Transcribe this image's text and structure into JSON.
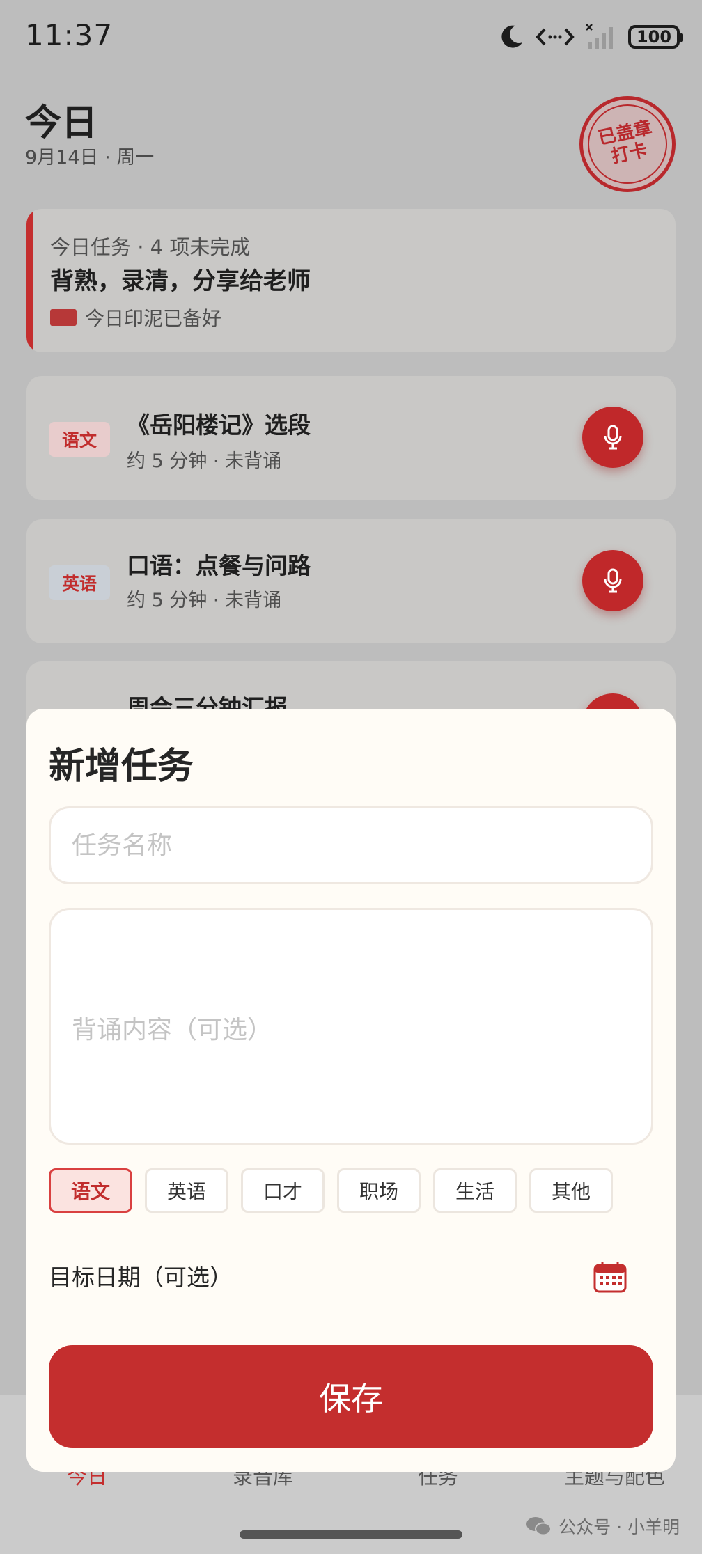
{
  "status_bar": {
    "time": "11:37",
    "battery": "100"
  },
  "header": {
    "title": "今日",
    "date": "9月14日 · 周一",
    "stamp_text": "已盖章打卡"
  },
  "summary": {
    "meta": "今日任务 · 4 项未完成",
    "goal": "背熟，录清，分享给老师",
    "ink_status": "今日印泥已备好"
  },
  "tasks": [
    {
      "subject": "语文",
      "title": "《岳阳楼记》选段",
      "subtitle": "约 5 分钟 · 未背诵"
    },
    {
      "subject": "英语",
      "title": "口语：点餐与问路",
      "subtitle": "约 5 分钟 · 未背诵"
    },
    {
      "subject": "",
      "title": "周会三分钟汇报",
      "subtitle": ""
    }
  ],
  "sheet": {
    "title": "新增任务",
    "name_placeholder": "任务名称",
    "content_placeholder": "背诵内容（可选）",
    "categories": [
      "语文",
      "英语",
      "口才",
      "职场",
      "生活",
      "其他"
    ],
    "selected_category": "语文",
    "date_label": "目标日期（可选）",
    "save_label": "保存"
  },
  "nav": {
    "items": [
      "今日",
      "录音库",
      "任务",
      "主题与配色"
    ],
    "active": "今日"
  },
  "watermark": "公众号 · 小羊明",
  "colors": {
    "accent": "#c42e2e",
    "sheet_bg": "#fffcf6",
    "overlay": "#bdbdbd"
  },
  "icons": [
    "moon-icon",
    "data-transfer-icon",
    "signal-icon",
    "battery-icon",
    "mic-icon",
    "calendar-icon",
    "wechat-icon"
  ]
}
